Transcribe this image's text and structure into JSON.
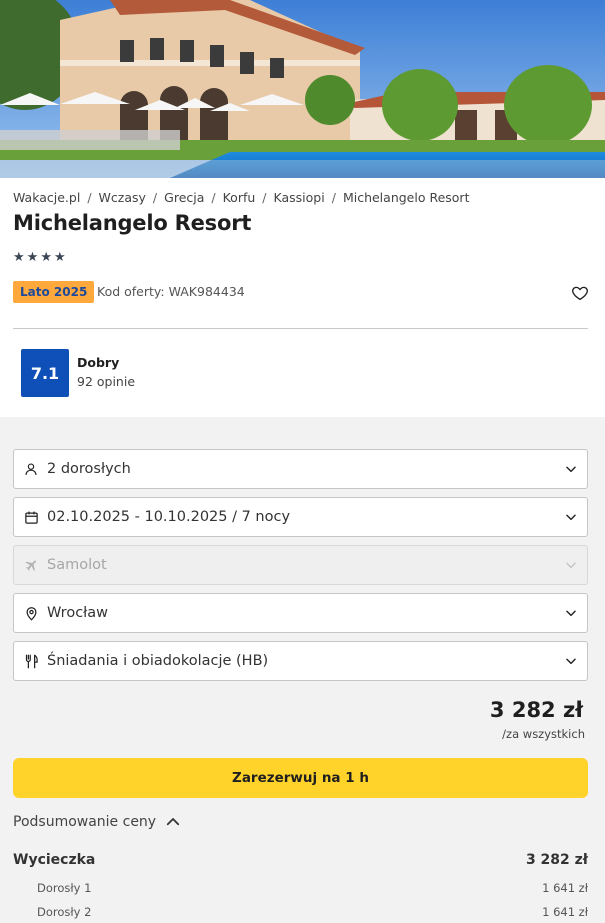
{
  "breadcrumb": [
    "Wakacje.pl",
    "Wczasy",
    "Grecja",
    "Korfu",
    "Kassiopi",
    "Michelangelo Resort"
  ],
  "hotel": {
    "name": "Michelangelo Resort",
    "stars": 4,
    "season_badge": "Lato 2025",
    "offer_code": "Kod oferty: WAK984434"
  },
  "rating": {
    "score": "7.1",
    "label": "Dobry",
    "reviews": "92 opinie"
  },
  "fields": {
    "guests": "2 dorosłych",
    "dates": "02.10.2025 - 10.10.2025 / 7 nocy",
    "transport": "Samolot",
    "departure": "Wrocław",
    "board": "Śniadania i obiadokolacje (HB)"
  },
  "price": {
    "total": "3 282 zł",
    "note": "/za wszystkich"
  },
  "book_button": "Zarezerwuj na 1 h",
  "summary": {
    "toggle_label": "Podsumowanie ceny",
    "trip_label": "Wycieczka",
    "trip_total": "3 282 zł",
    "items": [
      {
        "label": "Dorosły 1",
        "value": "1 641 zł"
      },
      {
        "label": "Dorosły 2",
        "value": "1 641 zł"
      }
    ]
  },
  "colors": {
    "accent_yellow": "#ffd32a",
    "season_orange": "#ffa83b",
    "score_blue": "#0e4fb8"
  }
}
